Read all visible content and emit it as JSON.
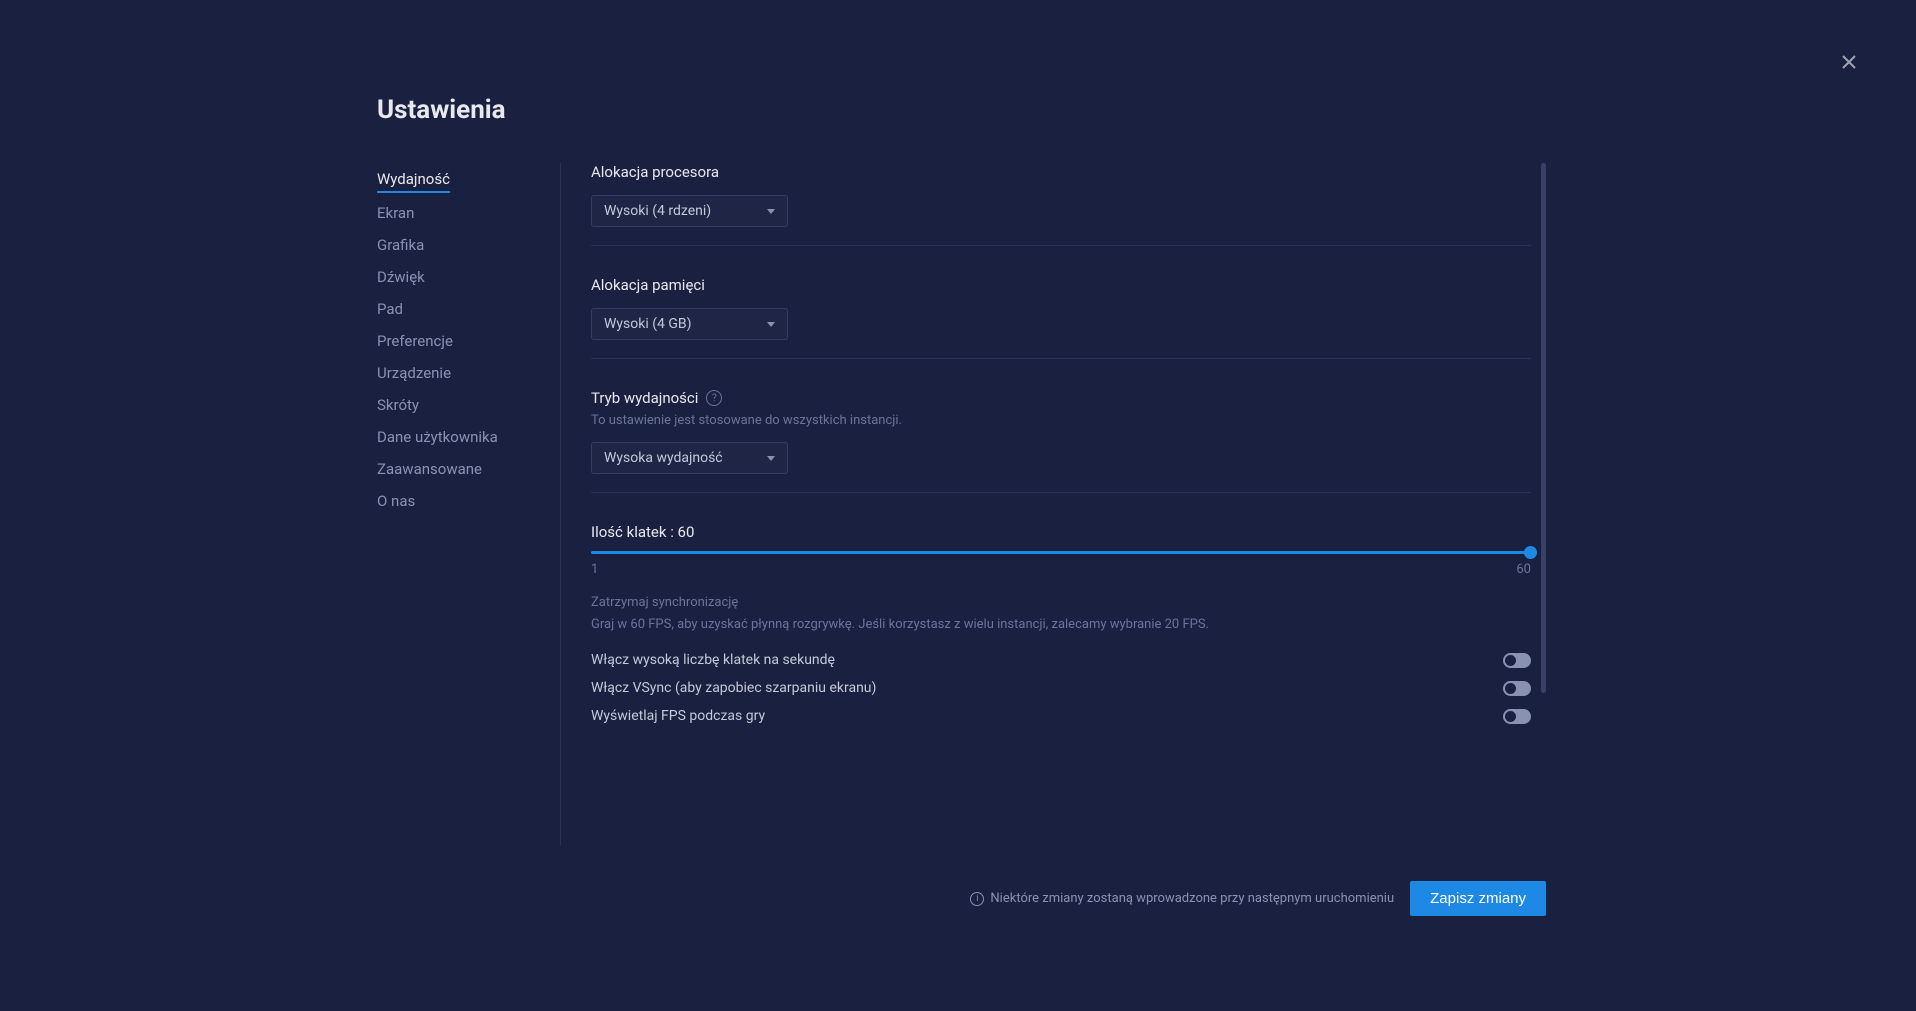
{
  "title": "Ustawienia",
  "sidebar": {
    "items": [
      {
        "label": "Wydajność",
        "active": true
      },
      {
        "label": "Ekran"
      },
      {
        "label": "Grafika"
      },
      {
        "label": "Dźwięk"
      },
      {
        "label": "Pad"
      },
      {
        "label": "Preferencje"
      },
      {
        "label": "Urządzenie"
      },
      {
        "label": "Skróty"
      },
      {
        "label": "Dane użytkownika"
      },
      {
        "label": "Zaawansowane"
      },
      {
        "label": "O nas"
      }
    ]
  },
  "sections": {
    "cpu": {
      "label": "Alokacja procesora",
      "value": "Wysoki (4 rdzeni)"
    },
    "memory": {
      "label": "Alokacja pamięci",
      "value": "Wysoki (4 GB)"
    },
    "perfMode": {
      "label": "Tryb wydajności",
      "subtext": "To ustawienie jest stosowane do wszystkich instancji.",
      "value": "Wysoka wydajność"
    },
    "fps": {
      "label": "Ilość klatek : 60",
      "min": "1",
      "max": "60",
      "syncText": "Zatrzymaj synchronizację",
      "desc": "Graj w 60 FPS, aby uzyskać płynną rozgrywkę. Jeśli korzystasz z wielu instancji, zalecamy wybranie 20 FPS."
    },
    "toggles": {
      "highFps": "Włącz wysoką liczbę klatek na sekundę",
      "vsync": "Włącz VSync (aby zapobiec szarpaniu ekranu)",
      "showFps": "Wyświetlaj FPS podczas gry"
    }
  },
  "footer": {
    "note": "Niektóre zmiany zostaną wprowadzone przy następnym uruchomieniu",
    "saveLabel": "Zapisz zmiany"
  }
}
